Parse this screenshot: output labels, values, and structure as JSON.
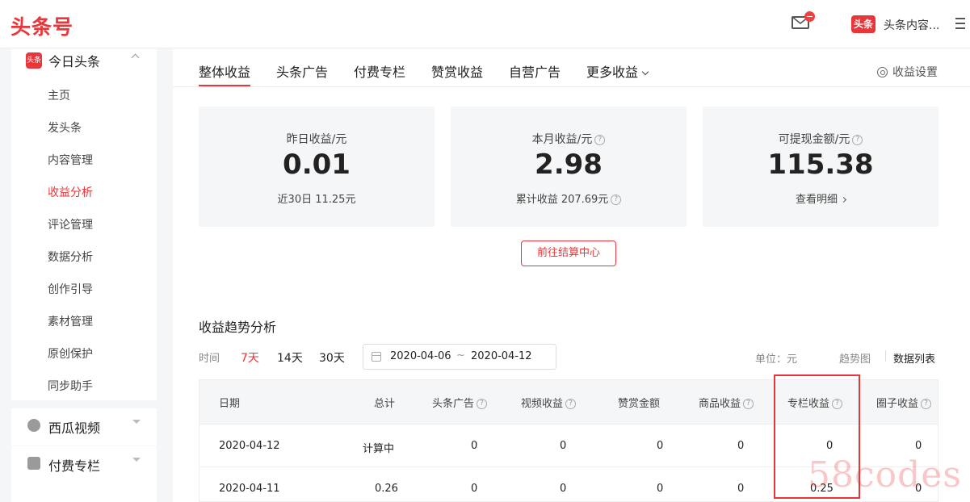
{
  "header": {
    "logo": "头条号",
    "username": "头条内容..."
  },
  "sidebar": {
    "section_badge": "头条",
    "section_label": "今日头条",
    "items": [
      {
        "label": "主页"
      },
      {
        "label": "发头条"
      },
      {
        "label": "内容管理"
      },
      {
        "label": "收益分析"
      },
      {
        "label": "评论管理"
      },
      {
        "label": "数据分析"
      },
      {
        "label": "创作引导"
      },
      {
        "label": "素材管理"
      },
      {
        "label": "原创保护"
      },
      {
        "label": "同步助手"
      }
    ],
    "groups": [
      {
        "label": "西瓜视频"
      },
      {
        "label": "付费专栏"
      }
    ]
  },
  "tabs": [
    {
      "label": "整体收益"
    },
    {
      "label": "头条广告"
    },
    {
      "label": "付费专栏"
    },
    {
      "label": "赞赏收益"
    },
    {
      "label": "自营广告"
    },
    {
      "label": "更多收益"
    }
  ],
  "settings_label": "收益设置",
  "cards": [
    {
      "label": "昨日收益/元",
      "value": "0.01",
      "sub": "近30日 11.25元"
    },
    {
      "label": "本月收益/元",
      "value": "2.98",
      "sub": "累计收益 207.69元"
    },
    {
      "label": "可提现金额/元",
      "value": "115.38",
      "sub": "查看明细"
    }
  ],
  "settle_button": "前往结算中心",
  "trend": {
    "title": "收益趋势分析",
    "time_label": "时间",
    "ranges": [
      "7天",
      "14天",
      "30天"
    ],
    "date_start": "2020-04-06",
    "date_sep": "~",
    "date_end": "2020-04-12",
    "unit": "单位：元",
    "view_trend": "趋势图",
    "view_list": "数据列表"
  },
  "table": {
    "headers": [
      "日期",
      "总计",
      "头条广告",
      "视频收益",
      "赞赏金额",
      "商品收益",
      "专栏收益",
      "圈子收益"
    ],
    "rows": [
      [
        "2020-04-12",
        "计算中",
        "0",
        "0",
        "0",
        "0",
        "0",
        "0"
      ],
      [
        "2020-04-11",
        "0.26",
        "0",
        "0",
        "0",
        "0",
        "0.25",
        "0"
      ]
    ]
  },
  "watermark": "58codes",
  "colors": {
    "accent": "#e8363a"
  }
}
